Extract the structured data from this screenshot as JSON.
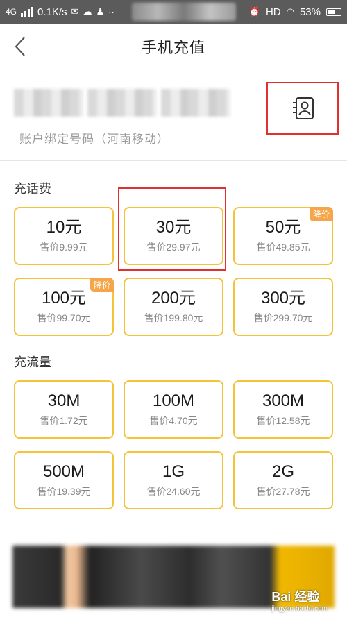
{
  "status_bar": {
    "network": "4G",
    "speed": "0.1K/s",
    "right_network": "HD",
    "battery": "53%"
  },
  "header": {
    "title": "手机充值"
  },
  "account": {
    "hint": "账户绑定号码（河南移动）"
  },
  "topup": {
    "title": "充话费",
    "items": [
      {
        "amount": "10元",
        "price": "售价9.99元",
        "badge": ""
      },
      {
        "amount": "30元",
        "price": "售价29.97元",
        "badge": ""
      },
      {
        "amount": "50元",
        "price": "售价49.85元",
        "badge": "降价"
      },
      {
        "amount": "100元",
        "price": "售价99.70元",
        "badge": "降价"
      },
      {
        "amount": "200元",
        "price": "售价199.80元",
        "badge": ""
      },
      {
        "amount": "300元",
        "price": "售价299.70元",
        "badge": ""
      }
    ]
  },
  "data": {
    "title": "充流量",
    "items": [
      {
        "amount": "30M",
        "price": "售价1.72元"
      },
      {
        "amount": "100M",
        "price": "售价4.70元"
      },
      {
        "amount": "300M",
        "price": "售价12.58元"
      },
      {
        "amount": "500M",
        "price": "售价19.39元"
      },
      {
        "amount": "1G",
        "price": "售价24.60元"
      },
      {
        "amount": "2G",
        "price": "售价27.78元"
      }
    ]
  },
  "watermark": {
    "brand": "Bai 经验",
    "url": "jingyan.baidu.com"
  },
  "colors": {
    "card_border": "#f3c43a",
    "badge": "#f5a54a",
    "highlight": "#e03030"
  }
}
